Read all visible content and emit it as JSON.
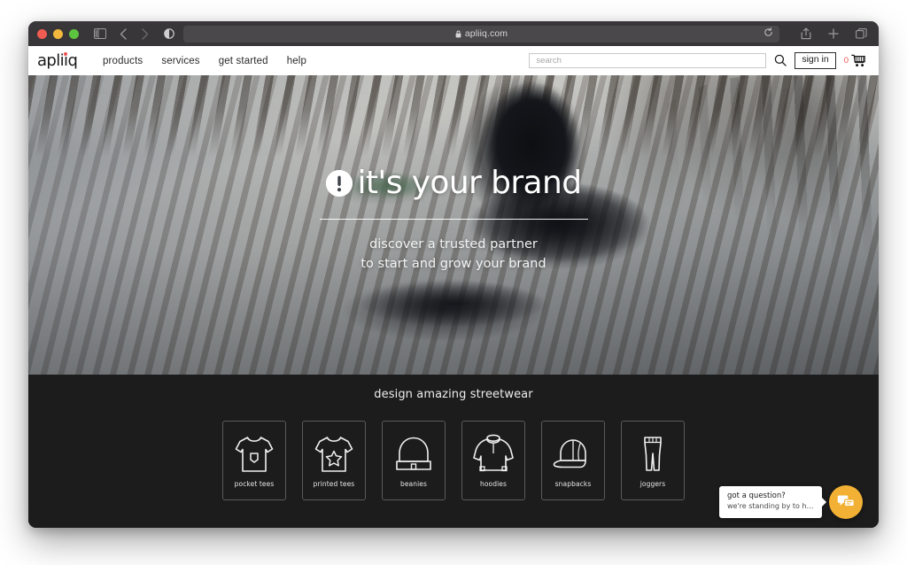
{
  "browser": {
    "url": "apliiq.com",
    "lock_icon": "lock-icon",
    "reload_icon": "reload-icon",
    "sidebar_icon": "sidebar-toggle-icon",
    "back_icon": "back-arrow-icon",
    "forward_icon": "forward-arrow-icon",
    "shield_icon": "privacy-shield-icon",
    "share_icon": "share-icon",
    "newtab_icon": "plus-icon",
    "tabs_icon": "tab-overview-icon",
    "traffic_lights": [
      "close",
      "minimize",
      "zoom"
    ]
  },
  "site": {
    "logo_text": "apliiq",
    "nav_items": [
      {
        "label": "products"
      },
      {
        "label": "services"
      },
      {
        "label": "get started"
      },
      {
        "label": "help"
      }
    ],
    "search": {
      "placeholder": "search",
      "value": "",
      "icon": "search-icon"
    },
    "sign_in_label": "sign in",
    "cart": {
      "count": "0",
      "icon": "shopping-cart-icon"
    }
  },
  "hero": {
    "badge_icon": "exclamation-circle-icon",
    "headline": "it's your brand",
    "subtitle_line1": "discover a trusted partner",
    "subtitle_line2": "to start and grow your brand"
  },
  "catalog": {
    "title": "design amazing streetwear",
    "tiles": [
      {
        "label": "pocket tees",
        "icon": "pocket-tee-icon"
      },
      {
        "label": "printed tees",
        "icon": "printed-tee-icon"
      },
      {
        "label": "beanies",
        "icon": "beanie-icon"
      },
      {
        "label": "hoodies",
        "icon": "hoodie-icon"
      },
      {
        "label": "snapbacks",
        "icon": "snapback-cap-icon"
      },
      {
        "label": "joggers",
        "icon": "joggers-icon"
      }
    ]
  },
  "chat": {
    "line1": "got a question?",
    "line2": "we're standing by to he...",
    "button_icon": "chat-bubbles-icon",
    "accent_color": "#f2b134"
  },
  "colors": {
    "cart_accent": "#e8534f",
    "logo_dot": "#e8534f",
    "dark_section": "#1c1c1c",
    "chat_accent": "#f2b134"
  }
}
